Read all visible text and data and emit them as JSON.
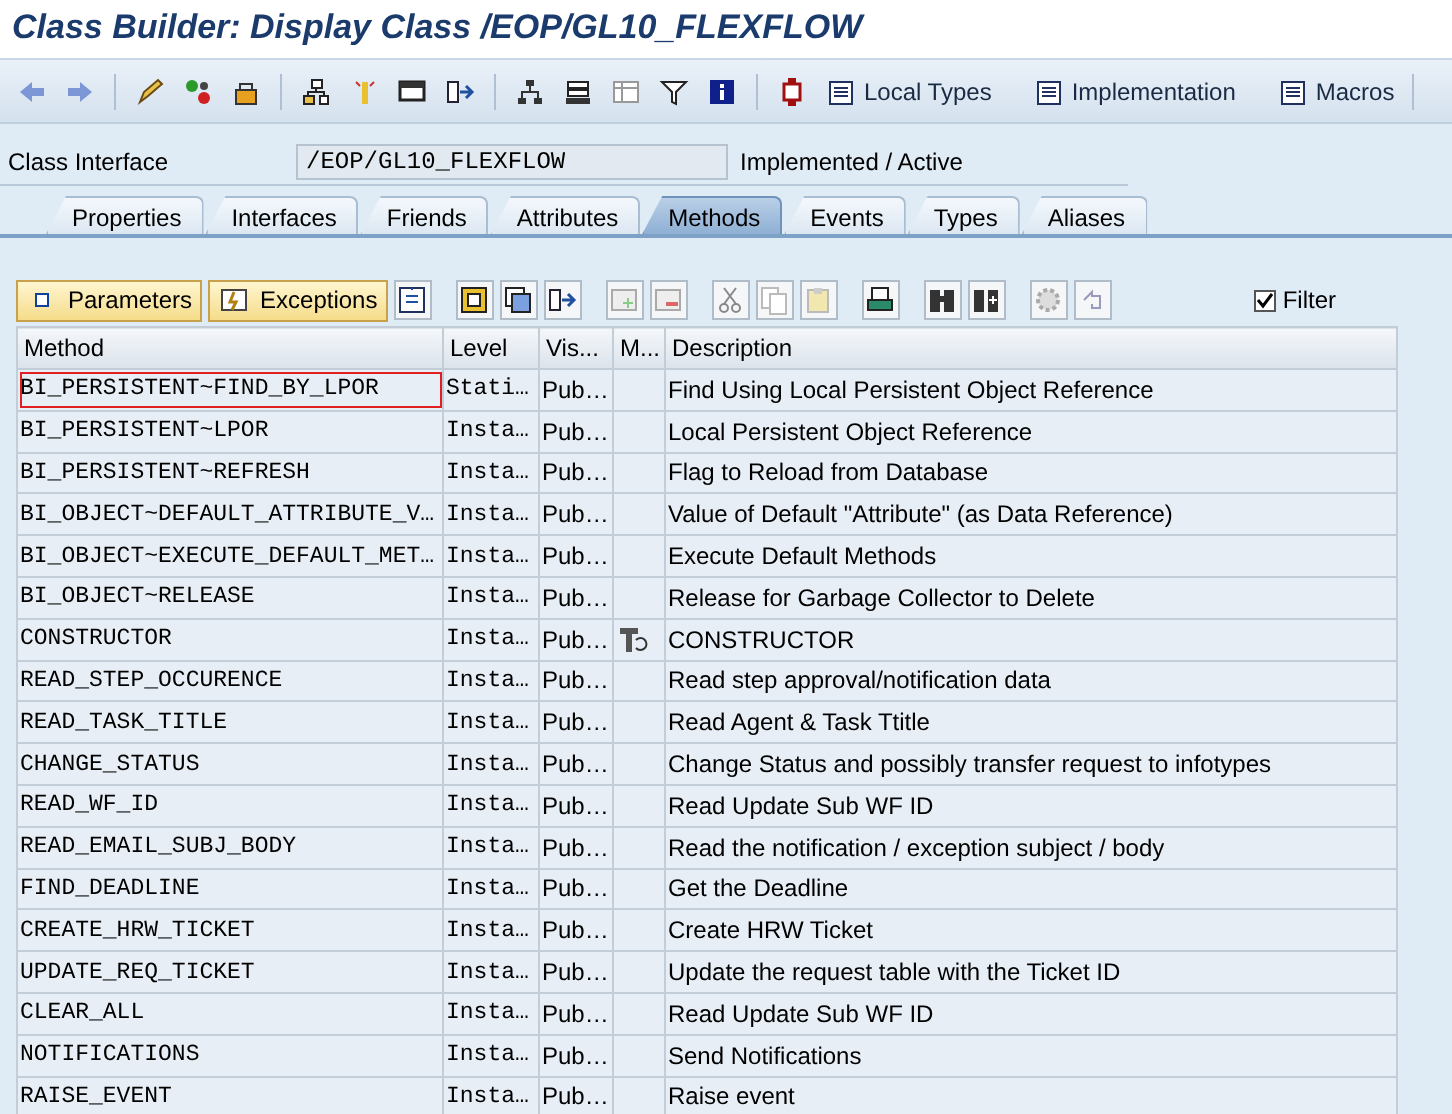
{
  "window": {
    "title": "Class Builder: Display Class /EOP/GL10_FLEXFLOW"
  },
  "toolbar": {
    "buttons": [
      {
        "label": "Local Types"
      },
      {
        "label": "Implementation"
      },
      {
        "label": "Macros"
      }
    ]
  },
  "class_interface": {
    "label": "Class Interface",
    "value": "/EOP/GL10_FLEXFLOW",
    "status": "Implemented / Active"
  },
  "tabs": [
    {
      "label": "Properties",
      "selected": false
    },
    {
      "label": "Interfaces",
      "selected": false
    },
    {
      "label": "Friends",
      "selected": false
    },
    {
      "label": "Attributes",
      "selected": false
    },
    {
      "label": "Methods",
      "selected": true
    },
    {
      "label": "Events",
      "selected": false
    },
    {
      "label": "Types",
      "selected": false
    },
    {
      "label": "Aliases",
      "selected": false
    }
  ],
  "methods_toolbar": {
    "buttons": [
      {
        "label": "Parameters"
      },
      {
        "label": "Exceptions"
      }
    ],
    "filter": {
      "label": "Filter",
      "checked": true
    }
  },
  "table": {
    "columns": [
      "Method",
      "Level",
      "Vis...",
      "M...",
      "Description"
    ],
    "rows": [
      {
        "method": "BI_PERSISTENT~FIND_BY_LPOR",
        "level": "Stati…",
        "visibility": "Pub…",
        "modeled": false,
        "description": "Find Using Local Persistent Object Reference",
        "focused": true
      },
      {
        "method": "BI_PERSISTENT~LPOR",
        "level": "Insta…",
        "visibility": "Pub…",
        "modeled": false,
        "description": "Local Persistent Object Reference",
        "focused": false
      },
      {
        "method": "BI_PERSISTENT~REFRESH",
        "level": "Insta…",
        "visibility": "Pub…",
        "modeled": false,
        "description": "Flag to Reload from Database",
        "focused": false
      },
      {
        "method": "BI_OBJECT~DEFAULT_ATTRIBUTE_V…",
        "level": "Insta…",
        "visibility": "Pub…",
        "modeled": false,
        "description": "Value of Default \"Attribute\" (as Data Reference)",
        "focused": false
      },
      {
        "method": "BI_OBJECT~EXECUTE_DEFAULT_MET…",
        "level": "Insta…",
        "visibility": "Pub…",
        "modeled": false,
        "description": "Execute Default Methods",
        "focused": false
      },
      {
        "method": "BI_OBJECT~RELEASE",
        "level": "Insta…",
        "visibility": "Pub…",
        "modeled": false,
        "description": "Release for Garbage Collector to Delete",
        "focused": false
      },
      {
        "method": "CONSTRUCTOR",
        "level": "Insta…",
        "visibility": "Pub…",
        "modeled": true,
        "description": "CONSTRUCTOR",
        "focused": false
      },
      {
        "method": "READ_STEP_OCCURENCE",
        "level": "Insta…",
        "visibility": "Pub…",
        "modeled": false,
        "description": "Read step approval/notification data",
        "focused": false
      },
      {
        "method": "READ_TASK_TITLE",
        "level": "Insta…",
        "visibility": "Pub…",
        "modeled": false,
        "description": "Read Agent & Task Ttitle",
        "focused": false
      },
      {
        "method": "CHANGE_STATUS",
        "level": "Insta…",
        "visibility": "Pub…",
        "modeled": false,
        "description": "Change Status and possibly transfer request to infotypes",
        "focused": false
      },
      {
        "method": "READ_WF_ID",
        "level": "Insta…",
        "visibility": "Pub…",
        "modeled": false,
        "description": "Read Update Sub WF ID",
        "focused": false
      },
      {
        "method": "READ_EMAIL_SUBJ_BODY",
        "level": "Insta…",
        "visibility": "Pub…",
        "modeled": false,
        "description": "Read the notification / exception subject / body",
        "focused": false
      },
      {
        "method": "FIND_DEADLINE",
        "level": "Insta…",
        "visibility": "Pub…",
        "modeled": false,
        "description": "Get the Deadline",
        "focused": false
      },
      {
        "method": "CREATE_HRW_TICKET",
        "level": "Insta…",
        "visibility": "Pub…",
        "modeled": false,
        "description": "Create HRW Ticket",
        "focused": false
      },
      {
        "method": "UPDATE_REQ_TICKET",
        "level": "Insta…",
        "visibility": "Pub…",
        "modeled": false,
        "description": "Update the request table with the Ticket ID",
        "focused": false
      },
      {
        "method": "CLEAR_ALL",
        "level": "Insta…",
        "visibility": "Pub…",
        "modeled": false,
        "description": "Read Update Sub WF ID",
        "focused": false
      },
      {
        "method": "NOTIFICATIONS",
        "level": "Insta…",
        "visibility": "Pub…",
        "modeled": false,
        "description": "Send Notifications",
        "focused": false
      },
      {
        "method": "RAISE_EVENT",
        "level": "Insta…",
        "visibility": "Pub…",
        "modeled": false,
        "description": "Raise event",
        "focused": false
      }
    ]
  }
}
